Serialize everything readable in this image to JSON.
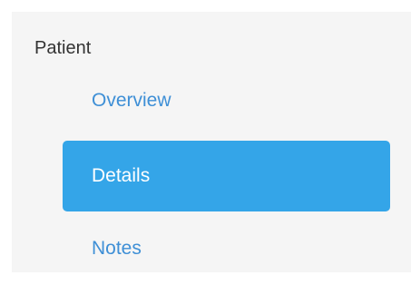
{
  "sidebar": {
    "heading": "Patient",
    "items": [
      {
        "label": "Overview",
        "active": false
      },
      {
        "label": "Details",
        "active": true
      },
      {
        "label": "Notes",
        "active": false
      }
    ]
  },
  "colors": {
    "panel_background": "#f5f5f5",
    "active_background": "#34a5e8",
    "link_text": "#3e8fd6",
    "active_text": "#ffffff",
    "heading_text": "#333333"
  }
}
